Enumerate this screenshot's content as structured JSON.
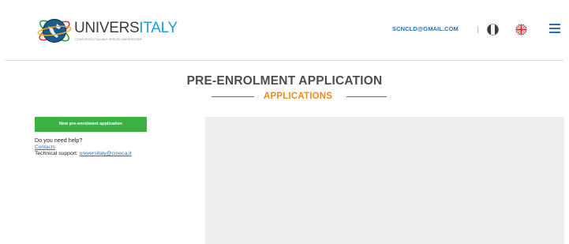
{
  "header": {
    "logo": {
      "word_a": "UNIVERS",
      "word_b": "ITALY",
      "tagline": "CONSORZIO ITALIANO SERVIZI UNIVERSITARI"
    },
    "user_email": "SCNCLD@GMAIL.COM",
    "languages": [
      "it",
      "en"
    ],
    "menu_icon": "hamburger-menu-icon"
  },
  "page": {
    "title": "PRE-ENROLMENT APPLICATION",
    "subtitle": "APPLICATIONS"
  },
  "sidebar": {
    "new_application_button": "New pre-enrolment application",
    "help_question": "Do you need help?",
    "contacts_link": "Contacts",
    "support_label": "Technical support:",
    "support_email": "universitaly@cineca.it"
  },
  "colors": {
    "accent_orange": "#f08a1c",
    "button_green": "#3cb043",
    "link_blue": "#2e6fb4",
    "brand_blue": "#19a0d6",
    "panel_gray": "#eeeeee"
  }
}
